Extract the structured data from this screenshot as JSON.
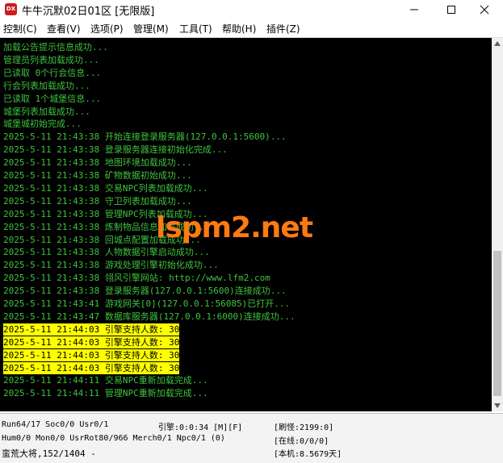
{
  "window": {
    "title": "牛牛沉默02日01区 [无限版]",
    "icon_label": "DX",
    "icon_color": "#c81e1e"
  },
  "menu": [
    {
      "label": "控制(C)"
    },
    {
      "label": "查看(V)"
    },
    {
      "label": "选项(P)"
    },
    {
      "label": "管理(M)"
    },
    {
      "label": "工具(T)"
    },
    {
      "label": "帮助(H)"
    },
    {
      "label": "插件(Z)"
    }
  ],
  "console": {
    "text_color": "#3fc23f",
    "highlight_color": "#ffff00",
    "lines": [
      {
        "text": "加载公告提示信息成功..."
      },
      {
        "text": "管理员列表加载成功..."
      },
      {
        "text": "已读取 0个行会信息..."
      },
      {
        "text": "行会列表加载成功..."
      },
      {
        "text": "已读取 1个城堡信息..."
      },
      {
        "text": "城堡列表加载成功..."
      },
      {
        "text": "城堡城初始完成..."
      },
      {
        "text": "2025-5-11 21:43:38 开始连接登录服务器(127.0.0.1:5600)..."
      },
      {
        "text": "2025-5-11 21:43:38 登录服务器连接初始化完成..."
      },
      {
        "text": "2025-5-11 21:43:38 地图环境加载成功..."
      },
      {
        "text": "2025-5-11 21:43:38 矿物数据初始成功..."
      },
      {
        "text": "2025-5-11 21:43:38 交易NPC列表加载成功..."
      },
      {
        "text": "2025-5-11 21:43:38 守卫列表加载成功..."
      },
      {
        "text": "2025-5-11 21:43:38 管理NPC列表加载成功..."
      },
      {
        "text": "2025-5-11 21:43:38 炼制物品信息加载成功..."
      },
      {
        "text": "2025-5-11 21:43:38 回城点配置加载成功..."
      },
      {
        "text": "2025-5-11 21:43:38 人物数据引擎启动成功..."
      },
      {
        "text": "2025-5-11 21:43:38 游戏处理引擎初始化成功..."
      },
      {
        "text": "2025-5-11 21:43:38 翎风引擎网站: http://www.lfm2.com"
      },
      {
        "text": "2025-5-11 21:43:38 登录服务器(127.0.0.1:5600)连接成功..."
      },
      {
        "text": "2025-5-11 21:43:41 游戏网关[0](127.0.0.1:56085)已打开..."
      },
      {
        "text": "2025-5-11 21:43:47 数据库服务器(127.0.0.1:6000)连接成功..."
      },
      {
        "text": "2025-5-11 21:44:03 引擎支持人数: 30",
        "highlight": true
      },
      {
        "text": "2025-5-11 21:44:03 引擎支持人数: 30",
        "highlight": true
      },
      {
        "text": "2025-5-11 21:44:03 引擎支持人数: 30",
        "highlight": true
      },
      {
        "text": "2025-5-11 21:44:03 引擎支持人数: 30",
        "highlight": true
      },
      {
        "text": "2025-5-11 21:44:11 交易NPC重新加载完成..."
      },
      {
        "text": "2025-5-11 21:44:11 管理NPC重新加载完成..."
      }
    ]
  },
  "watermark": {
    "text": "lspm2.net",
    "color": "#ff7a10"
  },
  "status": {
    "run": "Run64/17 Soc0/0 Usr0/1",
    "engine": "引擎:0:0:34 [M][F]",
    "refresh": "[刷怪:2199:0]",
    "hum": "Hum0/0 Mon0/0 UsrRot80/966 Merch0/1 Npc0/1 (0)",
    "online": "[在线:0/0/0]",
    "map": "蛮荒大将,152/1404 -",
    "local": "[本机:8.5679天]"
  }
}
